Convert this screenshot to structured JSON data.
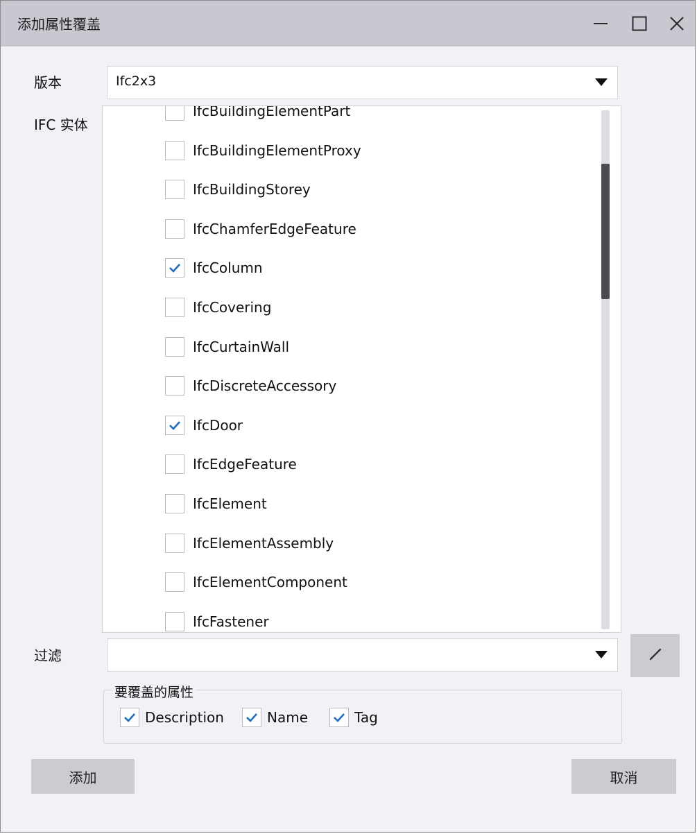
{
  "window": {
    "title": "添加属性覆盖",
    "controls": [
      "minimize-icon",
      "maximize-icon",
      "close-icon"
    ]
  },
  "version": {
    "label": "版本",
    "value": "Ifc2x3"
  },
  "entities": {
    "label": "IFC 实体",
    "items": [
      {
        "label": "IfcBuildingElementPart",
        "checked": false
      },
      {
        "label": "IfcBuildingElementProxy",
        "checked": false
      },
      {
        "label": "IfcBuildingStorey",
        "checked": false
      },
      {
        "label": "IfcChamferEdgeFeature",
        "checked": false
      },
      {
        "label": "IfcColumn",
        "checked": true
      },
      {
        "label": "IfcCovering",
        "checked": false
      },
      {
        "label": "IfcCurtainWall",
        "checked": false
      },
      {
        "label": "IfcDiscreteAccessory",
        "checked": false
      },
      {
        "label": "IfcDoor",
        "checked": true
      },
      {
        "label": "IfcEdgeFeature",
        "checked": false
      },
      {
        "label": "IfcElement",
        "checked": false
      },
      {
        "label": "IfcElementAssembly",
        "checked": false
      },
      {
        "label": "IfcElementComponent",
        "checked": false
      },
      {
        "label": "IfcFastener",
        "checked": false
      }
    ]
  },
  "filter": {
    "label": "过滤",
    "value": "",
    "edit_icon": "pencil-icon"
  },
  "properties": {
    "legend": "要覆盖的属性",
    "items": [
      {
        "label": "Description",
        "checked": true
      },
      {
        "label": "Name",
        "checked": true
      },
      {
        "label": "Tag",
        "checked": true
      }
    ]
  },
  "buttons": {
    "add": "添加",
    "cancel": "取消"
  },
  "colors": {
    "accent": "#1e6fc0",
    "titlebar": "#c8c8d0",
    "button": "#cbcbd2"
  }
}
